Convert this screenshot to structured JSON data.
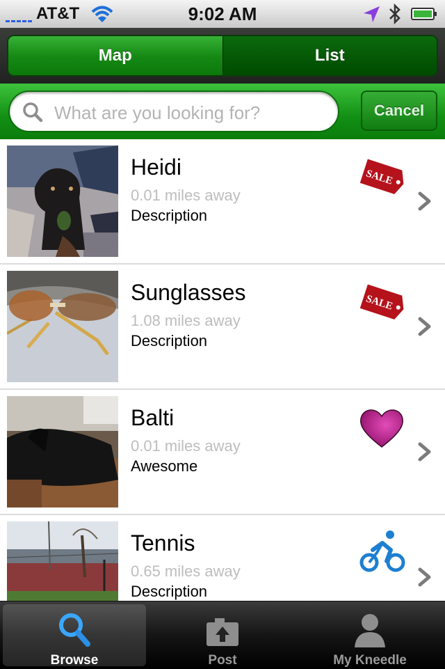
{
  "status_bar": {
    "carrier": "AT&T",
    "time": "9:02 AM"
  },
  "segments": {
    "map_label": "Map",
    "list_label": "List",
    "selected": "Map"
  },
  "search": {
    "placeholder": "What are you looking for?",
    "value": "",
    "cancel_label": "Cancel"
  },
  "items": [
    {
      "title": "Heidi",
      "distance": "0.01 miles away",
      "description": "Description",
      "badge": "sale-tag-icon",
      "badge_text": "SALE"
    },
    {
      "title": "Sunglasses",
      "distance": "1.08 miles away",
      "description": "Description",
      "badge": "sale-tag-icon",
      "badge_text": "SALE"
    },
    {
      "title": "Balti",
      "distance": "0.01 miles away",
      "description": "Awesome",
      "badge": "heart-icon"
    },
    {
      "title": "Tennis",
      "distance": "0.65 miles away",
      "description": "Description",
      "badge": "bicycle-icon"
    }
  ],
  "tabs": [
    {
      "label": "Browse",
      "icon": "search-icon",
      "selected": true
    },
    {
      "label": "Post",
      "icon": "upload-icon",
      "selected": false
    },
    {
      "label": "My Kneedle",
      "icon": "person-icon",
      "selected": false
    }
  ],
  "colors": {
    "accent_green": "#168a15",
    "sale_red": "#b5121b",
    "heart_magenta": "#c01a8e",
    "bike_blue": "#1d7fd0"
  }
}
